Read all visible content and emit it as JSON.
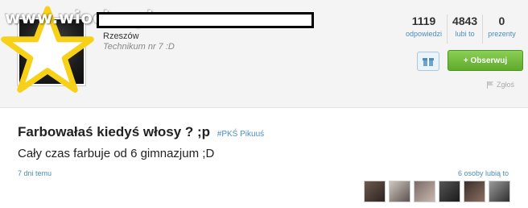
{
  "watermark": "www.wiocha.pl",
  "profile": {
    "city": "Rzeszów",
    "school": "Technikum nr 7 :D",
    "stats": [
      {
        "value": "1119",
        "label": "odpowiedzi"
      },
      {
        "value": "4843",
        "label": "lubi to"
      },
      {
        "value": "0",
        "label": "prezenty"
      }
    ],
    "follow_label": "+ Obserwuj",
    "report_label": "Zgłoś",
    "icons": {
      "gift": "gift-icon",
      "flag": "flag-icon",
      "star": "star-icon"
    }
  },
  "post": {
    "question": "Farbowałaś kiedyś włosy ? ;p",
    "tag": "#PKŚ Pikuuś",
    "answer": "Cały czas farbuje od 6 gimnazjum ;D",
    "timestamp": "7 dni temu",
    "likes_text": "6 osoby lubią to",
    "liker_count": 6
  },
  "colors": {
    "link": "#4a8cbf",
    "follow_green": "#6fbf3a",
    "star_yellow": "#f7d117"
  }
}
